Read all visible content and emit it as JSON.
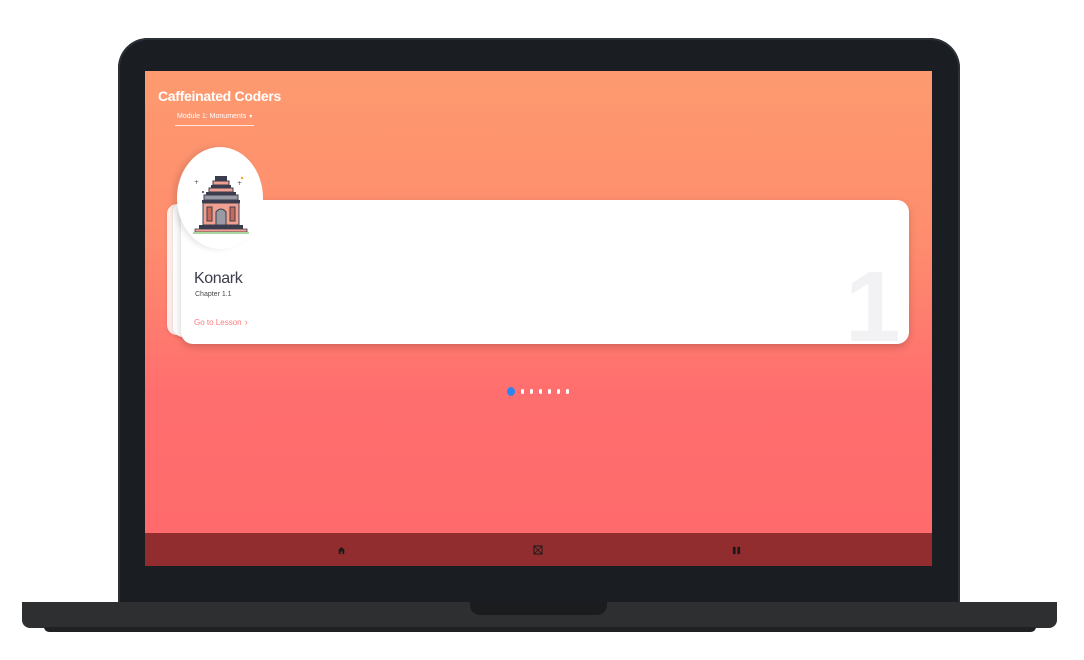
{
  "app": {
    "title": "Caffeinated Coders"
  },
  "module_selector": {
    "value": "Module 1: Monuments"
  },
  "lesson_card": {
    "title": "Konark",
    "chapter": "Chapter 1.1",
    "link_label": "Go to Lesson",
    "index_number": "1"
  },
  "carousel": {
    "total_pages": 7,
    "active_page": 1
  },
  "bottom_nav": {
    "items": [
      {
        "icon": "home-icon"
      },
      {
        "icon": "grid-icon"
      },
      {
        "icon": "book-icon"
      }
    ]
  },
  "colors": {
    "gradient_top": "#fd9a6f",
    "gradient_bottom": "#ff6a6b",
    "nav_bar": "#912d2e",
    "accent_dot": "#2f83f0",
    "link": "#ff7b7b"
  }
}
